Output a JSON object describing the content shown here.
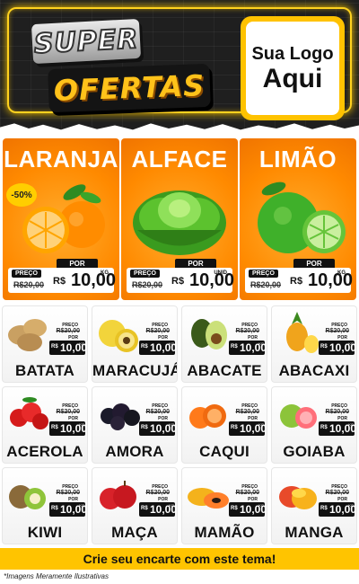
{
  "header": {
    "title_line1": "SUPER",
    "title_line2": "OFERTAS",
    "logo_line1": "Sua Logo",
    "logo_line2": "Aqui"
  },
  "colors": {
    "accent_orange": "#ff8a00",
    "accent_yellow": "#ffc400",
    "dark": "#111111"
  },
  "featured": [
    {
      "name": "LARANJA",
      "discount": "-50%",
      "preco_label": "PREÇO",
      "old_price": "R$20,00",
      "por_label": "POR",
      "currency": "R$",
      "price": "10,00",
      "unit": "KG",
      "icon": "orange-icon"
    },
    {
      "name": "ALFACE",
      "preco_label": "PREÇO",
      "old_price": "R$20,00",
      "por_label": "POR",
      "currency": "R$",
      "price": "10,00",
      "unit": "UNID",
      "icon": "lettuce-icon"
    },
    {
      "name": "LIMÃO",
      "preco_label": "PREÇO",
      "old_price": "R$20,00",
      "por_label": "POR",
      "currency": "R$",
      "price": "10,00",
      "unit": "KG",
      "icon": "lime-icon"
    }
  ],
  "products": [
    {
      "name": "BATATA",
      "preco_label": "PREÇO",
      "old_price": "R$20,00",
      "por_label": "POR",
      "currency": "R$",
      "price": "10,00",
      "unit": "KG",
      "icon": "potato-icon"
    },
    {
      "name": "MARACUJÁ",
      "preco_label": "PREÇO",
      "old_price": "R$20,00",
      "por_label": "POR",
      "currency": "R$",
      "price": "10,00",
      "unit": "KG",
      "icon": "passion-fruit-icon"
    },
    {
      "name": "ABACATE",
      "preco_label": "PREÇO",
      "old_price": "R$20,00",
      "por_label": "POR",
      "currency": "R$",
      "price": "10,00",
      "unit": "KG",
      "icon": "avocado-icon"
    },
    {
      "name": "ABACAXI",
      "preco_label": "PREÇO",
      "old_price": "R$20,00",
      "por_label": "POR",
      "currency": "R$",
      "price": "10,00",
      "unit": "KG",
      "icon": "pineapple-icon"
    },
    {
      "name": "ACEROLA",
      "preco_label": "PREÇO",
      "old_price": "R$20,00",
      "por_label": "POR",
      "currency": "R$",
      "price": "10,00",
      "unit": "KG",
      "icon": "acerola-icon"
    },
    {
      "name": "AMORA",
      "preco_label": "PREÇO",
      "old_price": "R$20,00",
      "por_label": "POR",
      "currency": "R$",
      "price": "10,00",
      "unit": "KG",
      "icon": "blackberry-icon"
    },
    {
      "name": "CAQUI",
      "preco_label": "PREÇO",
      "old_price": "R$20,00",
      "por_label": "POR",
      "currency": "R$",
      "price": "10,00",
      "unit": "KG",
      "icon": "persimmon-icon"
    },
    {
      "name": "GOIABA",
      "preco_label": "PREÇO",
      "old_price": "R$20,00",
      "por_label": "POR",
      "currency": "R$",
      "price": "10,00",
      "unit": "KG",
      "icon": "guava-icon"
    },
    {
      "name": "KIWI",
      "preco_label": "PREÇO",
      "old_price": "R$20,00",
      "por_label": "POR",
      "currency": "R$",
      "price": "10,00",
      "unit": "KG",
      "icon": "kiwi-icon"
    },
    {
      "name": "MAÇA",
      "preco_label": "PREÇO",
      "old_price": "R$20,00",
      "por_label": "POR",
      "currency": "R$",
      "price": "10,00",
      "unit": "KG",
      "icon": "apple-icon"
    },
    {
      "name": "MAMÃO",
      "preco_label": "PREÇO",
      "old_price": "R$20,00",
      "por_label": "POR",
      "currency": "R$",
      "price": "10,00",
      "unit": "KG",
      "icon": "papaya-icon"
    },
    {
      "name": "MANGA",
      "preco_label": "PREÇO",
      "old_price": "R$20,00",
      "por_label": "POR",
      "currency": "R$",
      "price": "10,00",
      "unit": "KG",
      "icon": "mango-icon"
    }
  ],
  "footer": {
    "cta": "Crie seu encarte com este tema!",
    "disclaimer": "*Imagens Meramente Ilustrativas"
  }
}
